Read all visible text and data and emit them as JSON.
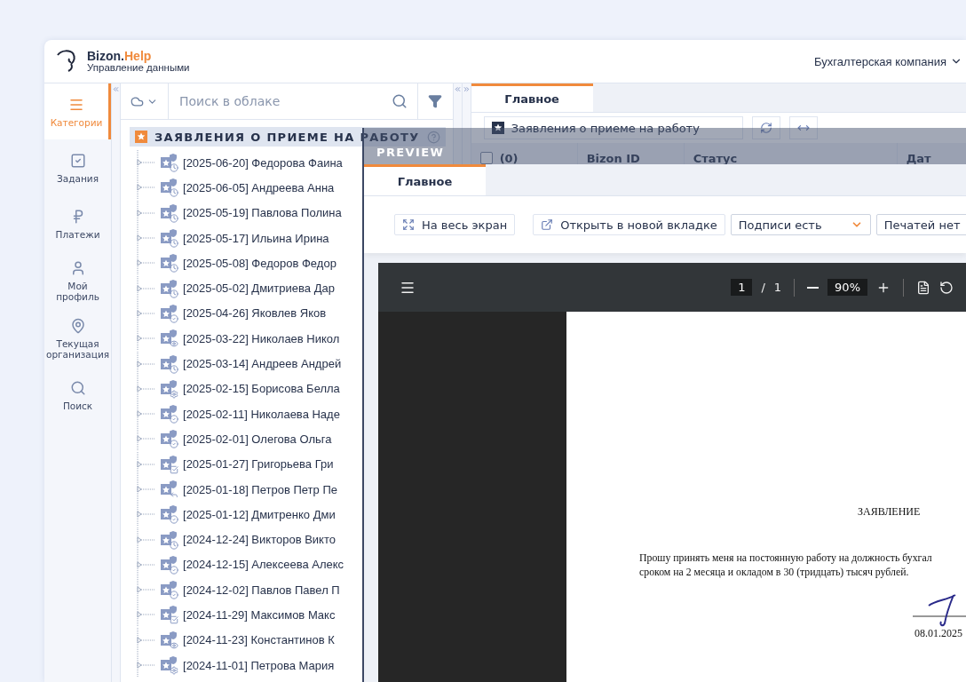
{
  "header": {
    "brand": {
      "name": "Bizon.",
      "accent": "Help"
    },
    "subtitle": "Управление данными",
    "company": "Бухгалтерская компания"
  },
  "sidebar": {
    "items": [
      {
        "label": "Категории",
        "selected": true
      },
      {
        "label": "Задания",
        "selected": false
      },
      {
        "label": "Платежи",
        "selected": false
      },
      {
        "label": "Мой профиль",
        "selected": false
      },
      {
        "label": "Текущая организация",
        "selected": false
      },
      {
        "label": "Поиск",
        "selected": false
      }
    ]
  },
  "search": {
    "placeholder": "Поиск в облаке"
  },
  "tree": {
    "title": "ЗАЯВЛЕНИЯ О ПРИЕМЕ НА РАБОТУ",
    "items": [
      {
        "label": "[2025-06-20] Федорова Фаина",
        "kind": "clock"
      },
      {
        "label": "[2025-06-05] Андреева Анна",
        "kind": "clock"
      },
      {
        "label": "[2025-05-19] Павлова Полина",
        "kind": "clock"
      },
      {
        "label": "[2025-05-17] Ильина Ирина",
        "kind": "clock"
      },
      {
        "label": "[2025-05-08] Федоров Федор",
        "kind": "clock"
      },
      {
        "label": "[2025-05-02] Дмитриева Дар",
        "kind": "clock"
      },
      {
        "label": "[2025-04-26] Яковлев Яков",
        "kind": "check"
      },
      {
        "label": "[2025-03-22] Николаев Никол",
        "kind": "eye"
      },
      {
        "label": "[2025-03-14] Андреев Андрей",
        "kind": "clock"
      },
      {
        "label": "[2025-02-15] Борисова Белла",
        "kind": "gear"
      },
      {
        "label": "[2025-02-11] Николаева Наде",
        "kind": "check"
      },
      {
        "label": "[2025-02-01] Олегова Ольга",
        "kind": "check"
      },
      {
        "label": "[2025-01-27] Григорьева Гри",
        "kind": "box"
      },
      {
        "label": "[2025-01-18] Петров Петр Пе",
        "kind": "reply"
      },
      {
        "label": "[2025-01-12] Дмитренко Дми",
        "kind": "check"
      },
      {
        "label": "[2024-12-24] Викторов Викто",
        "kind": "clock"
      },
      {
        "label": "[2024-12-15] Алексеева Алекс",
        "kind": "check"
      },
      {
        "label": "[2024-12-02] Павлов Павел П",
        "kind": "check"
      },
      {
        "label": "[2024-11-29] Максимов Макс",
        "kind": "box"
      },
      {
        "label": "[2024-11-23] Константинов К",
        "kind": "eye"
      },
      {
        "label": "[2024-11-01] Петрова Мария",
        "kind": "gear"
      }
    ]
  },
  "main": {
    "tabs": [
      {
        "label": "Главное",
        "selected": true
      }
    ],
    "category": "Заявления о приеме на работу",
    "columns": [
      "(0)",
      "Bizon ID",
      "Статус",
      "Дат"
    ]
  },
  "preview": {
    "title": "PREVIEW",
    "tabs": [
      {
        "label": "Главное",
        "selected": true
      }
    ],
    "buttons": [
      "На весь экран",
      "Открыть в новой вкладке"
    ],
    "selects": [
      {
        "value": "Подписи есть"
      },
      {
        "value": "Печатей нет"
      }
    ],
    "viewer": {
      "page": "1",
      "separator": "/",
      "total": "1",
      "zoom": "90%"
    },
    "document": {
      "heading": "ЗАЯВЛЕНИЕ",
      "lines": [
        "Прошу принять меня на постоянную работу на должность бухгал",
        "сроком на 2 месяца и окладом в 30 (тридцать) тысяч рублей."
      ],
      "date": "08.01.2025"
    }
  }
}
